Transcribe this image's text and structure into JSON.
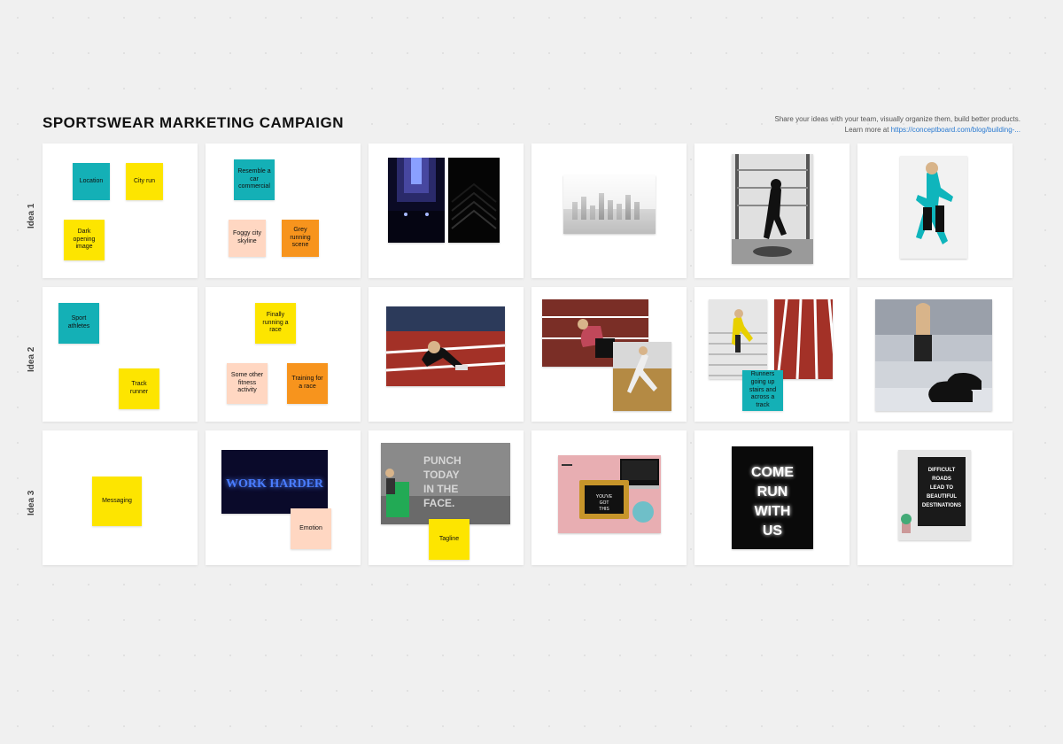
{
  "title": "SPORTSWEAR MARKETING CAMPAIGN",
  "help": {
    "line1": "Share your ideas with your team, visually organize them, build better products.",
    "line2_prefix": "Learn more at ",
    "link_text": "https://conceptboard.com/blog/building-..."
  },
  "rows": [
    {
      "label": "Idea 1"
    },
    {
      "label": "Idea 2"
    },
    {
      "label": "Idea 3"
    }
  ],
  "stickies": {
    "r1c1_a": "Location",
    "r1c1_b": "City run",
    "r1c1_c": "Dark opening image",
    "r1c2_a": "Resemble a car commercial",
    "r1c2_b": "Foggy city skyline",
    "r1c2_c": "Grey running scene",
    "r2c1_a": "Sport athletes",
    "r2c1_b": "Track runner",
    "r2c2_a": "Finally running a race",
    "r2c2_b": "Some other fitness activity",
    "r2c2_c": "Training for a race",
    "r2c5_a": "Runners going up stairs and across a track",
    "r3c1_a": "Messaging",
    "r3c2_a": "Emotion",
    "r3c3_a": "Tagline"
  },
  "photos": {
    "r3c2_neon": "WORK HARDER",
    "r3c3_punch": "PUNCH TODAY IN THE FACE.",
    "r3c4_chalk": "YOU'VE GOT THIS",
    "r3c5_sign": "COME RUN WITH US",
    "r3c6_board": "DIFFICULT ROADS LEAD TO BEAUTIFUL DESTINATIONS"
  }
}
